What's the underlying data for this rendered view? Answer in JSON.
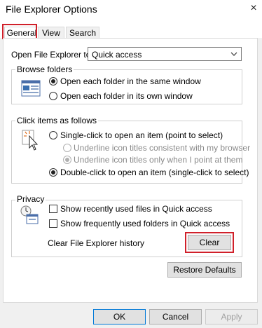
{
  "window": {
    "title": "File Explorer Options",
    "close_icon": "×"
  },
  "tabs": [
    {
      "label": "General",
      "active": true
    },
    {
      "label": "View",
      "active": false
    },
    {
      "label": "Search",
      "active": false
    }
  ],
  "open_explorer": {
    "label": "Open File Explorer to:",
    "value": "Quick access"
  },
  "browse_folders": {
    "legend": "Browse folders",
    "options": [
      {
        "label": "Open each folder in the same window",
        "checked": true
      },
      {
        "label": "Open each folder in its own window",
        "checked": false
      }
    ]
  },
  "click_items": {
    "legend": "Click items as follows",
    "options": [
      {
        "label": "Single-click to open an item (point to select)",
        "checked": false,
        "enabled": true
      },
      {
        "label": "Underline icon titles consistent with my browser",
        "checked": false,
        "enabled": false
      },
      {
        "label": "Underline icon titles only when I point at them",
        "checked": true,
        "enabled": false
      },
      {
        "label": "Double-click to open an item (single-click to select)",
        "checked": true,
        "enabled": true
      }
    ]
  },
  "privacy": {
    "legend": "Privacy",
    "show_recent_files": "Show recently used files in Quick access",
    "show_frequent_folders": "Show frequently used folders in Quick access",
    "clear_history_label": "Clear File Explorer history",
    "clear_button": "Clear"
  },
  "restore_defaults_button": "Restore Defaults",
  "footer": {
    "ok": "OK",
    "cancel": "Cancel",
    "apply": "Apply"
  },
  "colors": {
    "highlight": "#d0202a",
    "default_button_border": "#0078d7"
  }
}
